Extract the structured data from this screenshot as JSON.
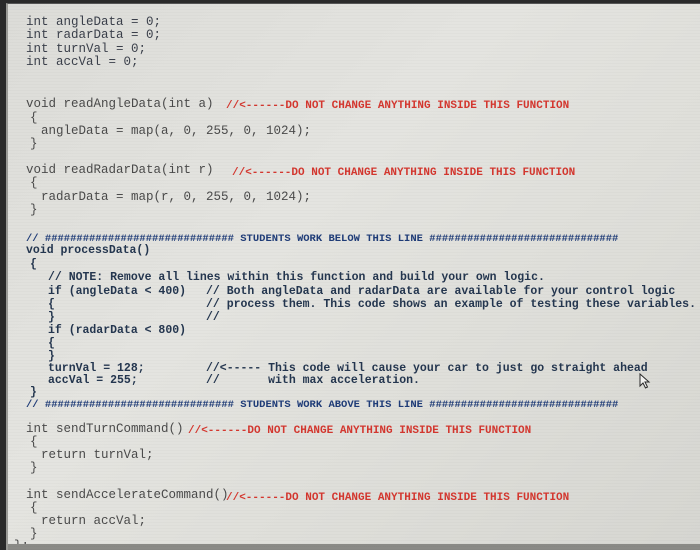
{
  "globals": [
    "int angleData = 0;",
    "int radarData = 0;",
    "int turnVal = 0;",
    "int accVal = 0;"
  ],
  "readAngle": {
    "signature": "void readAngleData(int a)",
    "warning": "//<------DO NOT CHANGE ANYTHING INSIDE THIS FUNCTION",
    "open": "{",
    "body": "angleData = map(a, 0, 255, 0, 1024);",
    "close": "}"
  },
  "readRadar": {
    "signature": "void readRadarData(int r)",
    "warning": "//<------DO NOT CHANGE ANYTHING INSIDE THIS FUNCTION",
    "open": "{",
    "body": "radarData = map(r, 0, 255, 0, 1024);",
    "close": "}"
  },
  "students": {
    "below_banner": "// ############################## STUDENTS WORK BELOW THIS LINE ##############################",
    "signature": "void processData()",
    "open": "{",
    "note": "// NOTE: Remove all lines within this function and build your own logic.",
    "if_angle": "if (angleData < 400)",
    "comment1": "// Both angleData and radarData are available for your control logic",
    "brace_open1": "{",
    "comment2": "// process them. This code shows an example of testing these variables.",
    "brace_close1": "}",
    "comment3": "//",
    "if_radar": "if (radarData < 800)",
    "brace_open2": "{",
    "brace_close2": "}",
    "turn_assign": "turnVal = 128;",
    "turn_comment": "//<----- This code will cause your car to just go straight ahead",
    "acc_assign": "accVal = 255;",
    "acc_comment": "//       with max acceleration.",
    "close": "}",
    "above_banner": "// ############################## STUDENTS WORK ABOVE THIS LINE ##############################"
  },
  "sendTurn": {
    "signature": "int sendTurnCommand()",
    "warning": "//<------DO NOT CHANGE ANYTHING INSIDE THIS FUNCTION",
    "open": "{",
    "body": "return turnVal;",
    "close": "}"
  },
  "sendAcc": {
    "signature": "int sendAccelerateCommand()",
    "warning": "//<------DO NOT CHANGE ANYTHING INSIDE THIS FUNCTION",
    "open": "{",
    "body": "return accVal;",
    "close": "}"
  },
  "closing": "};",
  "colors": {
    "warning_red": "#d4372f",
    "student_blue": "#1f3c78",
    "code_gray": "#4a4a4a"
  }
}
